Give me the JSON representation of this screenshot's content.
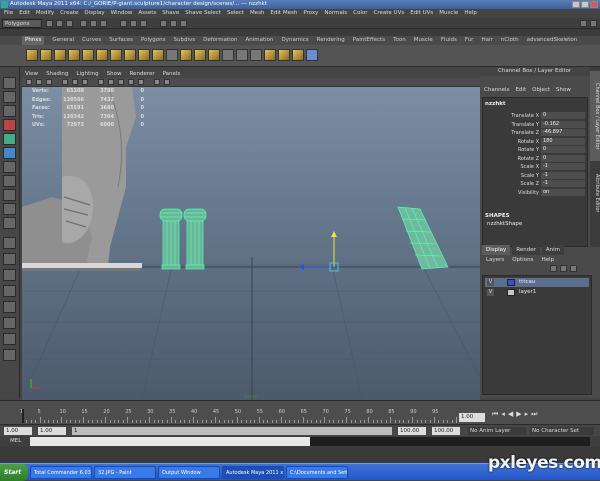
{
  "window": {
    "title": "Autodesk Maya 2011 x64: C:/_GORIE/P-giant.sculpture1/character design/scenes/... --- nzzhkt"
  },
  "menubar": [
    "File",
    "Edit",
    "Modify",
    "Create",
    "Display",
    "Window",
    "Assets",
    "Shave",
    "Shave Select",
    "Select",
    "Mesh",
    "Edit Mesh",
    "Proxy",
    "Normals",
    "Color",
    "Create UVs",
    "Edit UVs",
    "Muscle",
    "Help"
  ],
  "statusline": {
    "mode": "Polygons"
  },
  "shelf_tabs": [
    "Phnxs",
    "General",
    "Curves",
    "Surfaces",
    "Polygons",
    "Subdivs",
    "Deformation",
    "Animation",
    "Dynamics",
    "Rendering",
    "PaintEffects",
    "Toon",
    "Muscle",
    "Fluids",
    "Fur",
    "Hair",
    "nCloth",
    "advancedSkeleton"
  ],
  "shelf_active_tab": "Phnxs",
  "panel_menu": [
    "View",
    "Shading",
    "Lighting",
    "Show",
    "Renderer",
    "Panels"
  ],
  "hud": [
    {
      "label": "Verts:",
      "v1": "65308",
      "v2": "3780",
      "v3": "0"
    },
    {
      "label": "Edges:",
      "v1": "130566",
      "v2": "7432",
      "v3": "0"
    },
    {
      "label": "Faces:",
      "v1": "65591",
      "v2": "3680",
      "v3": "0"
    },
    {
      "label": "Tris:",
      "v1": "130342",
      "v2": "7304",
      "v3": "0"
    },
    {
      "label": "UVs:",
      "v1": "72973",
      "v2": "6000",
      "v3": "0"
    }
  ],
  "channel_box": {
    "header": "Channel Box / Layer Editor",
    "menu": [
      "Channels",
      "Edit",
      "Object",
      "Show"
    ],
    "object": "nzzhkt",
    "attributes": [
      {
        "name": "Translate X",
        "value": "0"
      },
      {
        "name": "Translate Y",
        "value": "-0.162"
      },
      {
        "name": "Translate Z",
        "value": "-46.897"
      },
      {
        "name": "Rotate X",
        "value": "180"
      },
      {
        "name": "Rotate Y",
        "value": "0"
      },
      {
        "name": "Rotate Z",
        "value": "0"
      },
      {
        "name": "Scale X",
        "value": "-1"
      },
      {
        "name": "Scale Y",
        "value": "-1"
      },
      {
        "name": "Scale Z",
        "value": "-1"
      },
      {
        "name": "Visibility",
        "value": "on"
      }
    ],
    "shapes_label": "SHAPES",
    "shape_name": "nzzhktShape",
    "side_tabs": [
      "Channel Box / Layer Editor",
      "Attribute Editor"
    ]
  },
  "layer_editor": {
    "tabs": [
      "Display",
      "Render",
      "Anim"
    ],
    "active_tab": "Display",
    "menu": [
      "Layers",
      "Options",
      "Help"
    ],
    "layers": [
      {
        "v": "V",
        "name": "tttcau",
        "color": "#3a4fcf",
        "selected": true
      },
      {
        "v": "V",
        "name": "layer1",
        "color": "#c8c8c8",
        "selected": false
      }
    ]
  },
  "time_slider": {
    "ticks": [
      "1",
      "5",
      "10",
      "15",
      "20",
      "25",
      "30",
      "35",
      "40",
      "45",
      "50",
      "55",
      "60",
      "65",
      "70",
      "75",
      "80",
      "85",
      "90",
      "95"
    ],
    "current_frame": "1.00"
  },
  "range_slider": {
    "start": "1.00",
    "inner_start": "1.00",
    "range_label": "1",
    "inner_end": "100.00",
    "end": "100.00",
    "anim_layer": "No Anim Layer",
    "character_set": "No Character Set"
  },
  "command_line": {
    "label": "MEL"
  },
  "taskbar": {
    "start_label": "Start",
    "tasks": [
      "Total Commander 6.03 - ...",
      "32.JPG - Paint",
      "Output Window",
      "Autodesk Maya 2011 x6...",
      "C:\\Documents and Settin..."
    ],
    "active_task_index": 3
  },
  "watermark": "pxleyes.com",
  "colors": {
    "viewport_top": "#7c8ea3",
    "viewport_bottom": "#4c5a6b",
    "wireframe_selected": "#4bffae",
    "manipulator_y": "#f0e040",
    "manipulator_x": "#3050e0"
  }
}
